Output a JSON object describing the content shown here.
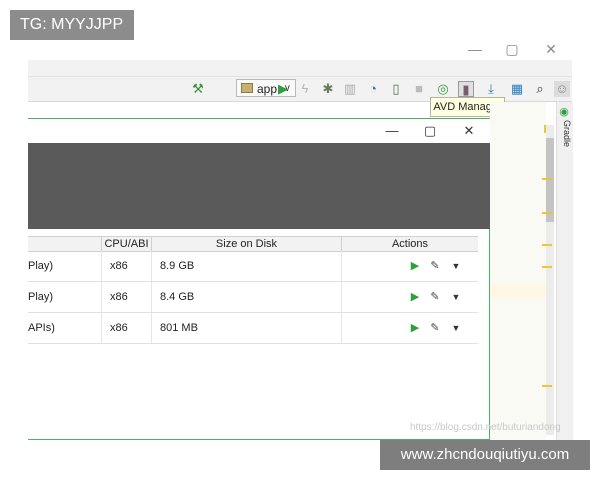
{
  "watermark_tag": "TG: MYYJJPP",
  "window_controls": {
    "minimize": "—",
    "maximize": "▢",
    "close": "✕"
  },
  "toolbar": {
    "run_config": "app",
    "chevron": "∨",
    "icons": [
      "hammer-icon",
      "app-config-icon",
      "run-icon",
      "apply-changes-icon",
      "debug-icon",
      "profile-icon",
      "attach-debugger-icon",
      "device-icon",
      "stop-icon",
      "sync-gradle-icon",
      "avd-manager-icon",
      "sdk-manager-icon",
      "project-structure-icon",
      "search-icon",
      "account-icon"
    ]
  },
  "tooltip": "AVD Manager",
  "gradle_label": "Gradle",
  "dialog": {
    "controls": {
      "minimize": "—",
      "maximize": "▢",
      "close": "✕"
    },
    "table": {
      "headers": [
        "",
        "CPU/ABI",
        "Size on Disk",
        "Actions"
      ],
      "rows": [
        {
          "name": "Play)",
          "cpu": "x86",
          "size": "8.9 GB"
        },
        {
          "name": "Play)",
          "cpu": "x86",
          "size": "8.4 GB"
        },
        {
          "name": "APIs)",
          "cpu": "x86",
          "size": "801 MB"
        }
      ],
      "actions": {
        "run": "▶",
        "edit": "✎",
        "more": "▼"
      }
    }
  },
  "footer_url": "https://blog.csdn.net/buturiandong",
  "banner": "www.zhcndouqiutiyu.com",
  "colors": {
    "accent_green": "#4db06a",
    "run_green": "#2e9e3e",
    "header_gray": "#5a5a5a",
    "tooltip_bg": "#ffffe1"
  }
}
